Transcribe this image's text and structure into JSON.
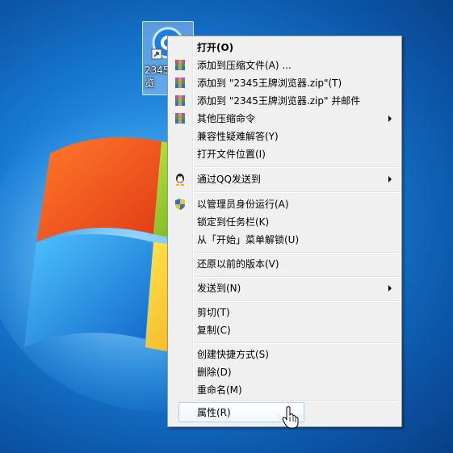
{
  "desktop": {
    "icon": {
      "label_line1": "2345",
      "label_line2": "览",
      "name": "2345-browser-shortcut-icon"
    }
  },
  "menu": {
    "items": [
      {
        "label": "打开(O)",
        "bold": true,
        "icon": ""
      },
      {
        "label": "添加到压缩文件(A) ...",
        "icon": "winrar-icon"
      },
      {
        "label": "添加到 \"2345王牌浏览器.zip\"(T)",
        "icon": "winrar-icon"
      },
      {
        "label": "添加到 \"2345王牌浏览器.zip\" 并邮件",
        "icon": "winrar-icon"
      },
      {
        "label": "其他压缩命令",
        "icon": "winrar-icon",
        "submenu": true
      },
      {
        "label": "兼容性疑难解答(Y)",
        "icon": ""
      },
      {
        "label": "打开文件位置(I)",
        "icon": ""
      },
      {
        "label": "通过QQ发送到",
        "icon": "qq-icon",
        "submenu": true
      },
      {
        "label": "以管理员身份运行(A)",
        "icon": "uac-shield-icon"
      },
      {
        "label": "锁定到任务栏(K)",
        "icon": ""
      },
      {
        "label": "从「开始」菜单解锁(U)",
        "icon": ""
      },
      {
        "label": "还原以前的版本(V)",
        "icon": ""
      },
      {
        "label": "发送到(N)",
        "icon": "",
        "submenu": true
      },
      {
        "label": "剪切(T)",
        "icon": ""
      },
      {
        "label": "复制(C)",
        "icon": ""
      },
      {
        "label": "创建快捷方式(S)",
        "icon": ""
      },
      {
        "label": "删除(D)",
        "icon": ""
      },
      {
        "label": "重命名(M)",
        "icon": ""
      },
      {
        "label": "属性(R)",
        "icon": "",
        "hover": true
      }
    ]
  },
  "colors": {
    "hover_border": "#aecff7",
    "menu_bg": "#f0f0f0",
    "desktop_blue": "#1673c9"
  }
}
